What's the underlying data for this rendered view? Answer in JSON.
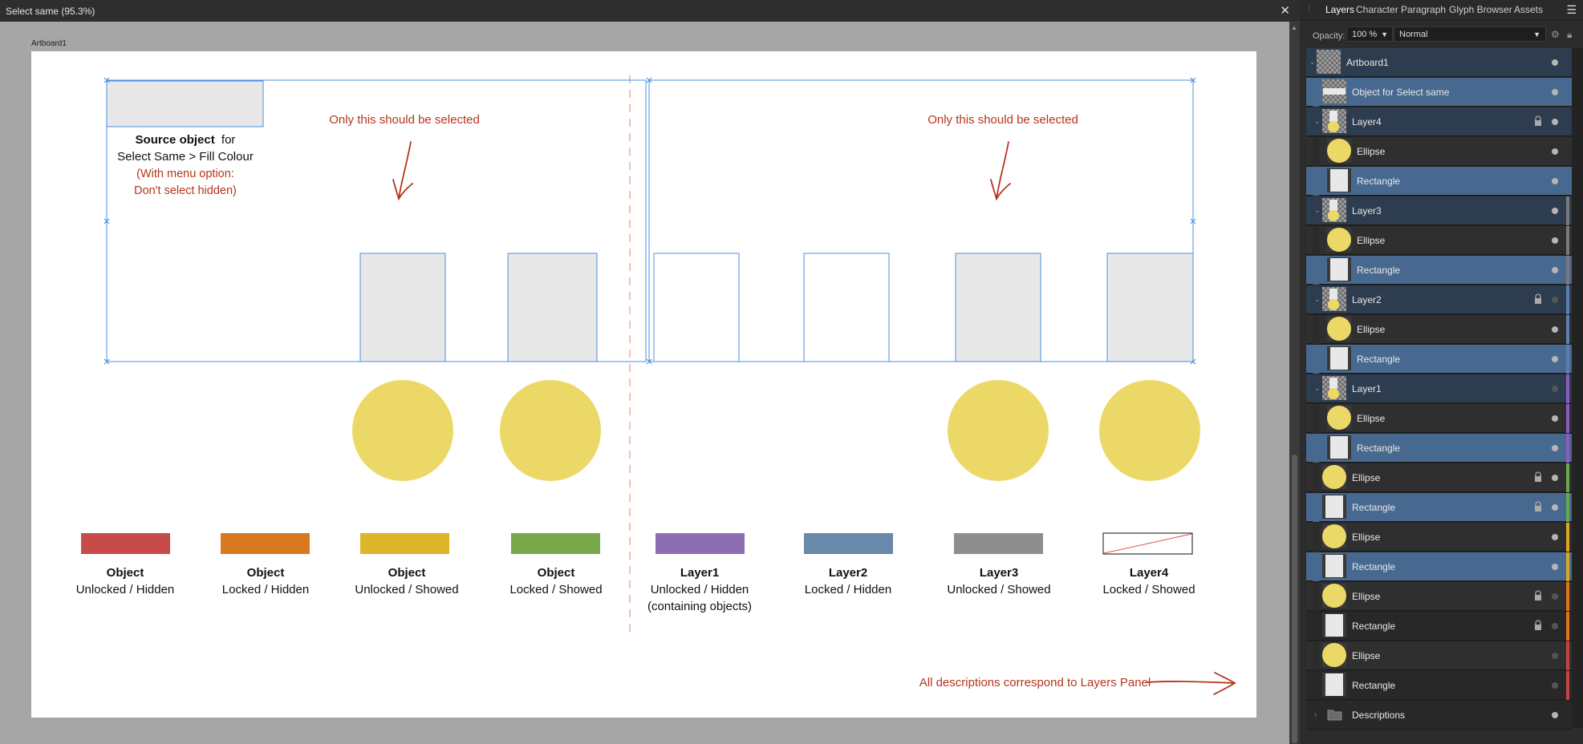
{
  "window": {
    "title": "Select same (95.3%)"
  },
  "artboard": {
    "label": "Artboard1"
  },
  "annotations": {
    "source_bold": "Source object",
    "source_tail": "for",
    "source_line2": "Select Same > Fill Colour",
    "menu_line1": "(With menu option:",
    "menu_line2": "Don't select hidden)",
    "only_left": "Only this should be selected",
    "only_right": "Only this should be selected",
    "footer": "All descriptions correspond to Layers Panel"
  },
  "legend": [
    {
      "title": "Object",
      "desc": "Unlocked / Hidden",
      "desc2": "",
      "color": "#c84b4b"
    },
    {
      "title": "Object",
      "desc": "Locked / Hidden",
      "desc2": "",
      "color": "#d8791f"
    },
    {
      "title": "Object",
      "desc": "Unlocked / Showed",
      "desc2": "",
      "color": "#dcb52a"
    },
    {
      "title": "Object",
      "desc": "Locked / Showed",
      "desc2": "",
      "color": "#79a84a"
    },
    {
      "title": "Layer1",
      "desc": "Unlocked / Hidden",
      "desc2": "(containing objects)",
      "color": "#8c6fb3"
    },
    {
      "title": "Layer2",
      "desc": "Locked / Hidden",
      "desc2": "",
      "color": "#6a88ac"
    },
    {
      "title": "Layer3",
      "desc": "Unlocked / Showed",
      "desc2": "",
      "color": "#8e8e8e"
    },
    {
      "title": "Layer4",
      "desc": "Locked / Showed",
      "desc2": "",
      "color": "none"
    }
  ],
  "colors": {
    "accent_red": "#b5351d",
    "selection_blue": "#4a90e2",
    "ellipse_fill": "#ecd866",
    "gray_fill": "#e8e8e8",
    "dashed_divider": "#f0c4a8"
  },
  "panel": {
    "tabs": [
      "Layers",
      "Character",
      "Paragraph",
      "Glyph Browser",
      "Assets"
    ],
    "opacity_label": "Opacity:",
    "opacity_value": "100 %",
    "blend_mode": "Normal",
    "layers": [
      {
        "name": "Artboard1",
        "kind": "artboard",
        "bg": "group",
        "indent": 0,
        "visible": true,
        "locked": false,
        "stripe": ""
      },
      {
        "name": "Object for Select same",
        "kind": "widerect",
        "bg": "sel",
        "indent": 1,
        "visible": true,
        "locked": false,
        "stripe": ""
      },
      {
        "name": "Layer4",
        "kind": "layer",
        "bg": "group",
        "indent": 1,
        "visible": true,
        "locked": true,
        "stripe": ""
      },
      {
        "name": "Ellipse",
        "kind": "ellipse",
        "bg": "plain",
        "indent": 2,
        "visible": true,
        "locked": false,
        "stripe": ""
      },
      {
        "name": "Rectangle",
        "kind": "rect",
        "bg": "sel",
        "indent": 2,
        "visible": true,
        "locked": false,
        "stripe": ""
      },
      {
        "name": "Layer3",
        "kind": "layer",
        "bg": "group",
        "indent": 1,
        "visible": true,
        "locked": false,
        "stripe": "#7a7a7a"
      },
      {
        "name": "Ellipse",
        "kind": "ellipse",
        "bg": "plain",
        "indent": 2,
        "visible": true,
        "locked": false,
        "stripe": "#7a7a7a"
      },
      {
        "name": "Rectangle",
        "kind": "rect",
        "bg": "sel",
        "indent": 2,
        "visible": true,
        "locked": false,
        "stripe": "#7a7a7a"
      },
      {
        "name": "Layer2",
        "kind": "layer",
        "bg": "group",
        "indent": 1,
        "visible": false,
        "locked": true,
        "stripe": "#5b7fb0"
      },
      {
        "name": "Ellipse",
        "kind": "ellipse",
        "bg": "plain",
        "indent": 2,
        "visible": true,
        "locked": false,
        "stripe": "#5b7fb0"
      },
      {
        "name": "Rectangle",
        "kind": "rect",
        "bg": "sel",
        "indent": 2,
        "visible": true,
        "locked": false,
        "stripe": "#5b7fb0"
      },
      {
        "name": "Layer1",
        "kind": "layer",
        "bg": "group",
        "indent": 1,
        "visible": false,
        "locked": false,
        "stripe": "#8a5cc0"
      },
      {
        "name": "Ellipse",
        "kind": "ellipse",
        "bg": "plain",
        "indent": 2,
        "visible": true,
        "locked": false,
        "stripe": "#8a5cc0"
      },
      {
        "name": "Rectangle",
        "kind": "rect",
        "bg": "sel",
        "indent": 2,
        "visible": true,
        "locked": false,
        "stripe": "#8a5cc0"
      },
      {
        "name": "Ellipse",
        "kind": "ellipse",
        "bg": "plain",
        "indent": 1,
        "visible": true,
        "locked": true,
        "stripe": "#6aa84f"
      },
      {
        "name": "Rectangle",
        "kind": "rect",
        "bg": "sel",
        "indent": 1,
        "visible": true,
        "locked": true,
        "stripe": "#6aa84f"
      },
      {
        "name": "Ellipse",
        "kind": "ellipse",
        "bg": "plain",
        "indent": 1,
        "visible": true,
        "locked": false,
        "stripe": "#d9a82a"
      },
      {
        "name": "Rectangle",
        "kind": "rect",
        "bg": "sel",
        "indent": 1,
        "visible": true,
        "locked": false,
        "stripe": "#d9a82a"
      },
      {
        "name": "Ellipse",
        "kind": "ellipse",
        "bg": "plain",
        "indent": 1,
        "visible": false,
        "locked": true,
        "stripe": "#d9761e"
      },
      {
        "name": "Rectangle",
        "kind": "rect",
        "bg": "dark",
        "indent": 1,
        "visible": false,
        "locked": true,
        "stripe": "#d9761e"
      },
      {
        "name": "Ellipse",
        "kind": "ellipse",
        "bg": "plain",
        "indent": 1,
        "visible": false,
        "locked": false,
        "stripe": "#c94242"
      },
      {
        "name": "Rectangle",
        "kind": "rect",
        "bg": "dark",
        "indent": 1,
        "visible": false,
        "locked": false,
        "stripe": "#c94242"
      },
      {
        "name": "Descriptions",
        "kind": "folder",
        "bg": "dark",
        "indent": 1,
        "visible": true,
        "locked": false,
        "stripe": ""
      }
    ]
  }
}
